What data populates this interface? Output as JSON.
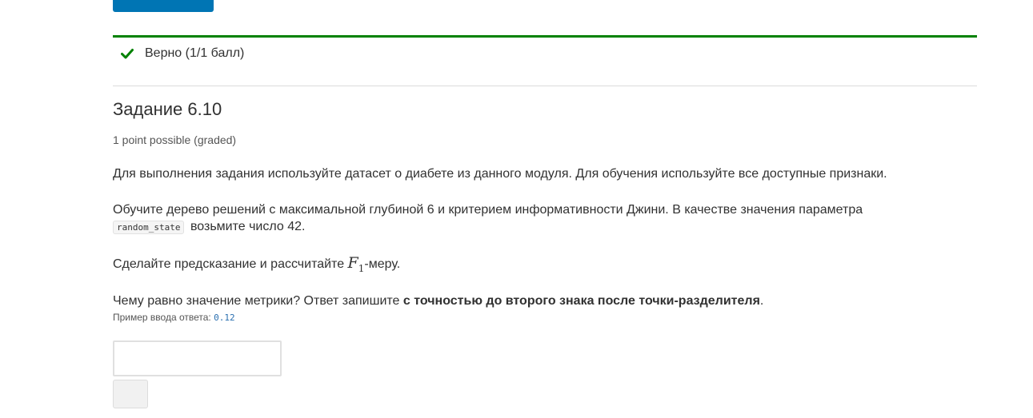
{
  "status": {
    "text": "Верно (1/1 балл)",
    "color": "#008100",
    "icon": "checkmark-icon"
  },
  "problem": {
    "title": "Задание 6.10",
    "points": "1 point possible (graded)",
    "p1": "Для выполнения задания используйте датасет о диабете из данного модуля. Для обучения используйте все доступные признаки.",
    "p2_before": "Обучите дерево решений с максимальной глубиной 6 и критерием информативности Джини. В качестве значения параметра",
    "p2_code": "random_state",
    "p2_after": "возьмите число 42.",
    "p3_before": "Сделайте предсказание и рассчитайте",
    "p3_math_var": "F",
    "p3_math_sub": "1",
    "p3_after": "-меру.",
    "p4_before": "Чему равно значение метрики? Ответ запишите",
    "p4_bold": "с точностью до второго знака после точки-разделителя",
    "p4_after": ".",
    "hint_label": "Пример ввода ответа:",
    "hint_code": "0.12"
  },
  "answer": {
    "value": "",
    "submit_label": ""
  },
  "colors": {
    "accent": "#0075b4",
    "success": "#008100"
  }
}
